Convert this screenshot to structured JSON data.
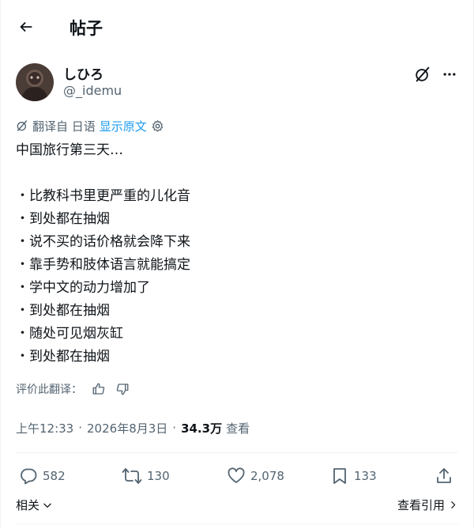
{
  "header": {
    "title": "帖子",
    "back_icon": "arrow-left-icon"
  },
  "author": {
    "name": "しひろ",
    "handle": "@_idemu"
  },
  "translation": {
    "label": "翻译自 日语",
    "show_original": "显示原文"
  },
  "tweet": {
    "lines": [
      "中国旅行第三天…",
      "",
      "・比教科书里更严重的儿化音",
      "・到处都在抽烟",
      "・说不买的话价格就会降下来",
      "・靠手势和肢体语言就能搞定",
      "・学中文的动力增加了",
      "・到处都在抽烟",
      "・随处可见烟灰缸",
      "・到处都在抽烟"
    ]
  },
  "rate_translation": {
    "label": "评价此翻译："
  },
  "meta": {
    "time": "上午12:33",
    "date": "2026年8月3日",
    "views_count": "34.3万",
    "views_label": "查看"
  },
  "actions": {
    "replies": "582",
    "reposts": "130",
    "likes": "2,078",
    "bookmarks": "133"
  },
  "footer": {
    "related": "相关",
    "view_quotes": "查看引用"
  },
  "colors": {
    "text": "#0f1419",
    "secondary": "#536471",
    "link": "#1d9bf0",
    "divider": "#eff3f4"
  }
}
